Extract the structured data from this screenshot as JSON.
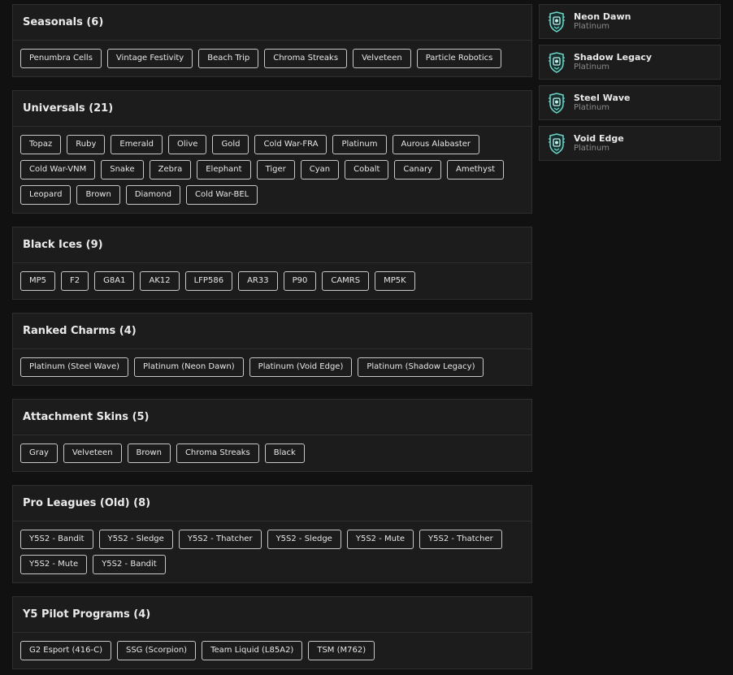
{
  "sections": [
    {
      "title": "Seasonals (6)",
      "items": [
        "Penumbra Cells",
        "Vintage Festivity",
        "Beach Trip",
        "Chroma Streaks",
        "Velveteen",
        "Particle Robotics"
      ]
    },
    {
      "title": "Universals (21)",
      "items": [
        "Topaz",
        "Ruby",
        "Emerald",
        "Olive",
        "Gold",
        "Cold War-FRA",
        "Platinum",
        "Aurous Alabaster",
        "Cold War-VNM",
        "Snake",
        "Zebra",
        "Elephant",
        "Tiger",
        "Cyan",
        "Cobalt",
        "Canary",
        "Amethyst",
        "Leopard",
        "Brown",
        "Diamond",
        "Cold War-BEL"
      ]
    },
    {
      "title": "Black Ices (9)",
      "items": [
        "MP5",
        "F2",
        "G8A1",
        "AK12",
        "LFP586",
        "AR33",
        "P90",
        "CAMRS",
        "MP5K"
      ]
    },
    {
      "title": "Ranked Charms (4)",
      "items": [
        "Platinum (Steel Wave)",
        "Platinum (Neon Dawn)",
        "Platinum (Void Edge)",
        "Platinum (Shadow Legacy)"
      ]
    },
    {
      "title": "Attachment Skins (5)",
      "items": [
        "Gray",
        "Velveteen",
        "Brown",
        "Chroma Streaks",
        "Black"
      ]
    },
    {
      "title": "Pro Leagues (Old) (8)",
      "items": [
        "Y5S2 - Bandit",
        "Y5S2 - Sledge",
        "Y5S2 - Thatcher",
        "Y5S2 - Sledge",
        "Y5S2 - Mute",
        "Y5S2 - Thatcher",
        "Y5S2 - Mute",
        "Y5S2 - Bandit"
      ]
    },
    {
      "title": "Y5 Pilot Programs (4)",
      "items": [
        "G2 Esport (416-C)",
        "SSG (Scorpion)",
        "Team Liquid (L85A2)",
        "TSM (M762)"
      ]
    }
  ],
  "charms": [
    {
      "name": "Neon Dawn",
      "tier": "Platinum",
      "icon": "platinum-rank-icon"
    },
    {
      "name": "Shadow Legacy",
      "tier": "Platinum",
      "icon": "platinum-rank-icon"
    },
    {
      "name": "Steel Wave",
      "tier": "Platinum",
      "icon": "platinum-rank-icon"
    },
    {
      "name": "Void Edge",
      "tier": "Platinum",
      "icon": "platinum-rank-icon"
    }
  ],
  "colors": {
    "background": "#111111",
    "panel": "#1c1c1c",
    "tag_border": "#c8c8c8",
    "platinum_accent": "#6fd6c8"
  }
}
